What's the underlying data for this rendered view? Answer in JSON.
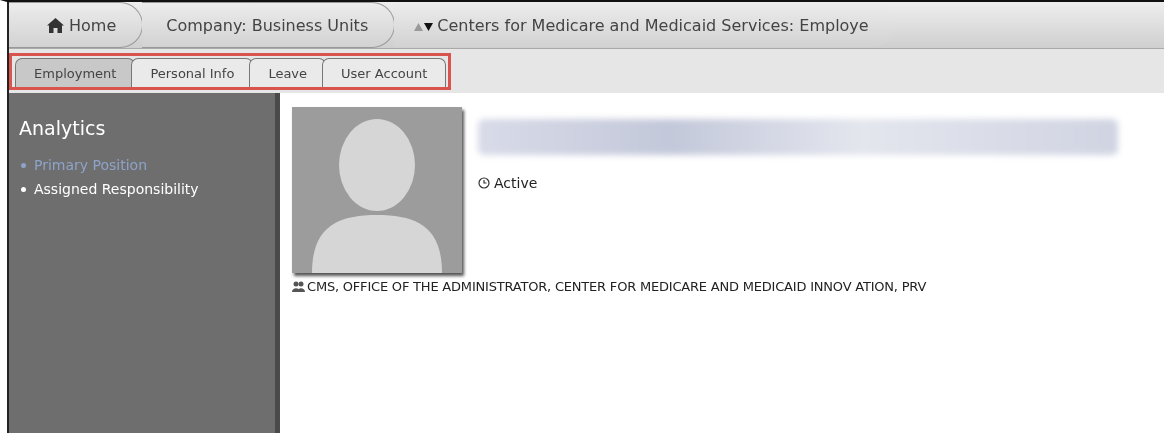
{
  "breadcrumbs": [
    {
      "kind": "home",
      "label": "Home"
    },
    {
      "kind": "plain",
      "label": "Company: Business Units"
    },
    {
      "kind": "sortable",
      "label": "Centers for Medicare and Medicaid Services: Employe"
    }
  ],
  "tabs": [
    {
      "label": "Employment",
      "selected": true
    },
    {
      "label": "Personal Info",
      "selected": false
    },
    {
      "label": "Leave",
      "selected": false
    },
    {
      "label": "User Account",
      "selected": false
    }
  ],
  "sidebar": {
    "title": "Analytics",
    "items": [
      {
        "label": "Primary Position",
        "selected": true
      },
      {
        "label": "Assigned Responsibility",
        "selected": false
      }
    ]
  },
  "profile": {
    "status": "Active",
    "organization": "CMS, OFFICE OF THE ADMINISTRATOR, CENTER FOR MEDICARE AND MEDICAID INNOV ATION, PRV"
  }
}
